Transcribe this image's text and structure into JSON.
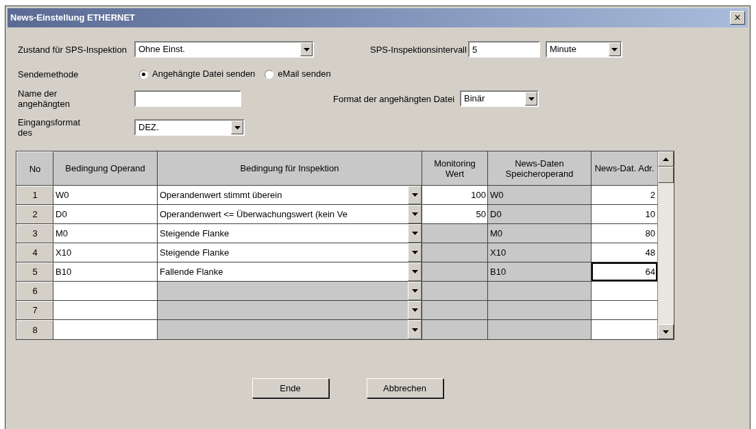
{
  "window": {
    "title": "News-Einstellung ETHERNET",
    "close": "×"
  },
  "state_label": "Zustand für SPS-Inspektion",
  "state_value": "Ohne Einst.",
  "interval_label": "SPS-Inspektionsintervall",
  "interval_value": "5",
  "interval_unit": "Minute",
  "send_method_label": "Sendemethode",
  "send_methods": [
    {
      "label": "Angehängte Datei senden",
      "selected": true
    },
    {
      "label": "eMail senden",
      "selected": false
    }
  ],
  "attachment_name_label": "Name der angehängten",
  "attachment_format_label": "Format der angehängten Datei",
  "attachment_format_value": "Binär",
  "input_format_label": "Eingangsformat des",
  "input_format_value": "DEZ.",
  "table": {
    "columns": [
      "No",
      "Bedingung Operand",
      "Bedingung für Inspektion",
      "Monitoring Wert",
      "News-Daten Speicheroperand",
      "News-Dat. Adr."
    ],
    "rows": [
      {
        "no": "1",
        "operand": "W0",
        "condition": "Operandenwert stimmt überein",
        "condition_enabled": true,
        "monitoring": "100",
        "monitoring_enabled": true,
        "storage": "W0",
        "address": "2",
        "focused": false
      },
      {
        "no": "2",
        "operand": "D0",
        "condition": "Operandenwert <= Überwachungswert (kein Ve",
        "condition_enabled": true,
        "monitoring": "50",
        "monitoring_enabled": true,
        "storage": "D0",
        "address": "10",
        "focused": false
      },
      {
        "no": "3",
        "operand": "M0",
        "condition": "Steigende Flanke",
        "condition_enabled": true,
        "monitoring_enabled": false,
        "storage": "M0",
        "address": "80",
        "focused": false
      },
      {
        "no": "4",
        "operand": "X10",
        "condition": "Steigende Flanke",
        "condition_enabled": true,
        "monitoring_enabled": false,
        "storage": "X10",
        "address": "48",
        "focused": false
      },
      {
        "no": "5",
        "operand": "B10",
        "condition": "Fallende Flanke",
        "condition_enabled": true,
        "monitoring_enabled": false,
        "storage": "B10",
        "address": "64",
        "focused": true
      },
      {
        "no": "6",
        "condition_enabled": false,
        "monitoring_enabled": false,
        "focused": false
      },
      {
        "no": "7",
        "condition_enabled": false,
        "monitoring_enabled": false,
        "focused": false
      },
      {
        "no": "8",
        "condition_enabled": false,
        "monitoring_enabled": false,
        "focused": false
      }
    ]
  },
  "buttons": [
    "Ende",
    "Abbrechen"
  ]
}
